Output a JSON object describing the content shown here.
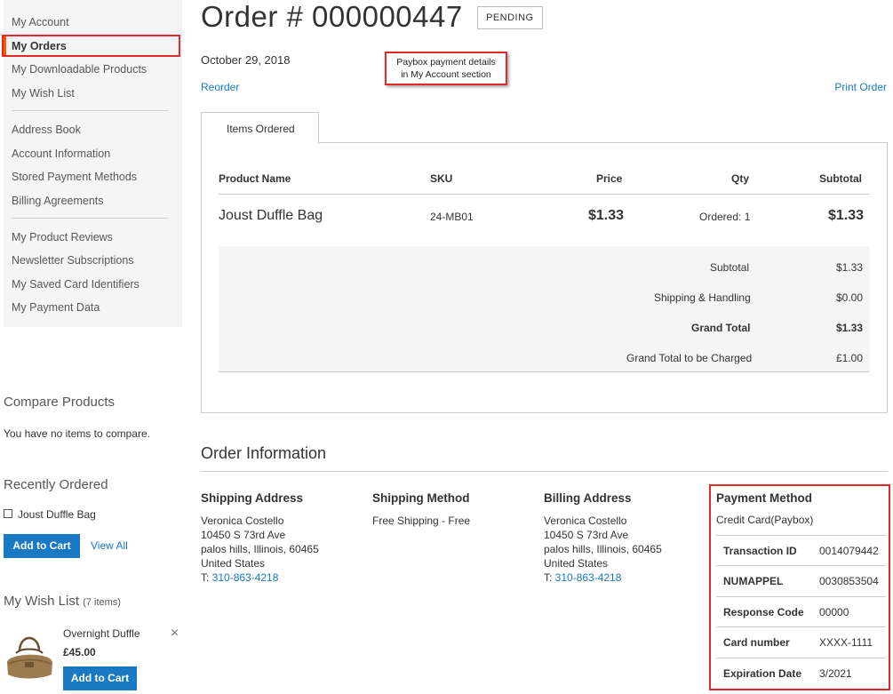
{
  "nav": {
    "items": [
      {
        "label": "My Account"
      },
      {
        "label": "My Orders"
      },
      {
        "label": "My Downloadable Products"
      },
      {
        "label": "My Wish List"
      },
      {
        "label": "Address Book"
      },
      {
        "label": "Account Information"
      },
      {
        "label": "Stored Payment Methods"
      },
      {
        "label": "Billing Agreements"
      },
      {
        "label": "My Product Reviews"
      },
      {
        "label": "Newsletter Subscriptions"
      },
      {
        "label": "My Saved Card Identifiers"
      },
      {
        "label": "My Payment Data"
      }
    ],
    "active": "My Orders"
  },
  "compare": {
    "title": "Compare Products",
    "empty": "You have no items to compare."
  },
  "recent": {
    "title": "Recently Ordered",
    "item": "Joust Duffle Bag",
    "add_to_cart": "Add to Cart",
    "view_all": "View All"
  },
  "wishlist": {
    "title": "My Wish List",
    "count": "(7 items)",
    "item_name": "Overnight Duffle",
    "item_price": "£45.00",
    "add_to_cart": "Add to Cart",
    "remove_icon": "×"
  },
  "order": {
    "title": "Order # 000000447",
    "status": "PENDING",
    "date": "October 29, 2018",
    "reorder": "Reorder",
    "print": "Print Order"
  },
  "callout": {
    "line1": "Paybox payment details",
    "line2": "in My Account section"
  },
  "tabs": {
    "items_ordered": "Items Ordered"
  },
  "items_table": {
    "headers": {
      "product": "Product Name",
      "sku": "SKU",
      "price": "Price",
      "qty": "Qty",
      "subtotal": "Subtotal"
    },
    "rows": [
      {
        "product": "Joust Duffle Bag",
        "sku": "24-MB01",
        "price": "$1.33",
        "qty": "Ordered: 1",
        "subtotal": "$1.33"
      }
    ],
    "totals": [
      {
        "label": "Subtotal",
        "value": "$1.33"
      },
      {
        "label": "Shipping & Handling",
        "value": "$0.00"
      },
      {
        "label": "Grand Total",
        "value": "$1.33"
      },
      {
        "label": "Grand Total to be Charged",
        "value": "£1.00"
      }
    ]
  },
  "order_info": {
    "title": "Order Information",
    "shipping_address": {
      "title": "Shipping Address",
      "name": "Veronica Costello",
      "street": "10450 S 73rd Ave",
      "city": "palos hills, Illinois, 60465",
      "country": "United States",
      "phone_prefix": "T: ",
      "phone": "310-863-4218"
    },
    "shipping_method": {
      "title": "Shipping Method",
      "value": "Free Shipping - Free"
    },
    "billing_address": {
      "title": "Billing Address",
      "name": "Veronica Costello",
      "street": "10450 S 73rd Ave",
      "city": "palos hills, Illinois, 60465",
      "country": "United States",
      "phone_prefix": "T: ",
      "phone": "310-863-4218"
    },
    "payment_method": {
      "title": "Payment Method",
      "name": "Credit Card(Paybox)",
      "rows": [
        {
          "label": "Transaction ID",
          "value": "0014079442"
        },
        {
          "label": "NUMAPPEL",
          "value": "0030853504"
        },
        {
          "label": "Response Code",
          "value": "00000"
        },
        {
          "label": "Card number",
          "value": "XXXX-1111"
        },
        {
          "label": "Expiration Date",
          "value": "3/2021"
        }
      ]
    }
  },
  "colors": {
    "accent": "#1979c3",
    "highlight": "#e02b27",
    "active_bar": "#ff5501"
  }
}
